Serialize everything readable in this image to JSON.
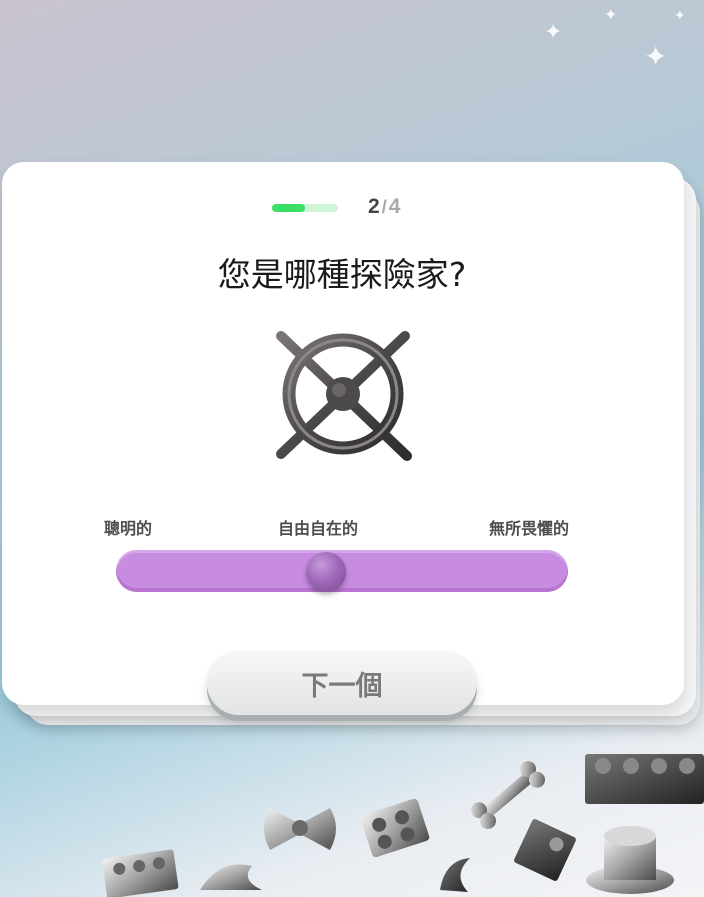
{
  "quiz": {
    "progress": {
      "current": "2",
      "separator": "/",
      "total": "4",
      "fraction": 0.5
    },
    "question": "您是哪種探險家?",
    "image_icon": "ship-wheel-icon",
    "scale": {
      "left_label": "聰明的",
      "middle_label": "自由自在的",
      "right_label": "無所畏懼的",
      "value": 0.46
    },
    "next_button_label": "下一個"
  },
  "colors": {
    "progress_fill": "#39df67",
    "progress_track": "#cdf6d8",
    "slider_track": "#c78be0",
    "slider_thumb": "#9a63b3",
    "button_bg": "#ececec"
  }
}
